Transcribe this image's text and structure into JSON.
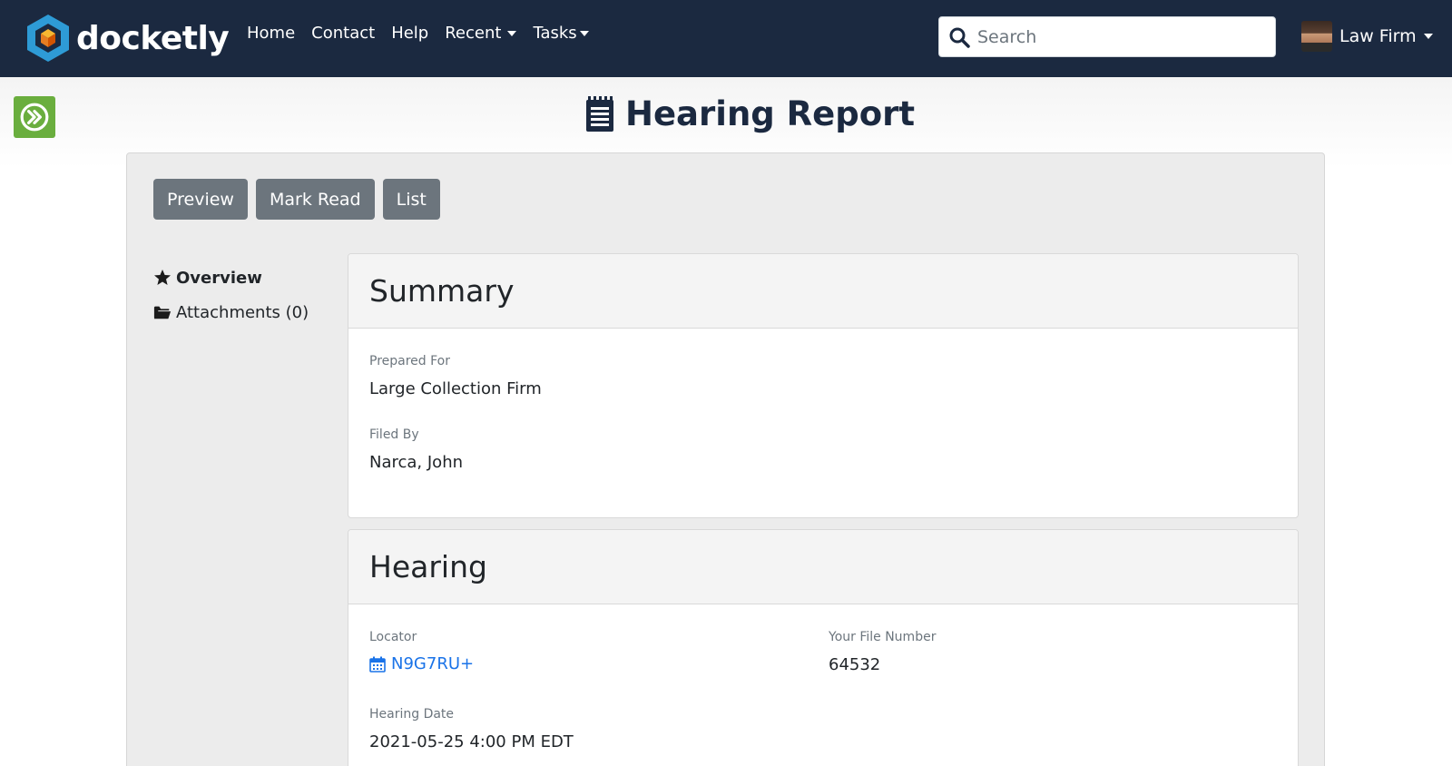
{
  "brand": {
    "name": "docketly",
    "colors": {
      "hex_blue": "#2e9bd6",
      "hex_orange": "#f39c12"
    }
  },
  "nav": {
    "links": [
      "Home",
      "Contact",
      "Help",
      "Recent",
      "Tasks"
    ],
    "search_placeholder": "Search",
    "user_name": "Law Firm"
  },
  "page": {
    "title": "Hearing Report",
    "title_icon": "notepad-icon"
  },
  "actions": {
    "preview": "Preview",
    "mark_read": "Mark Read",
    "list": "List"
  },
  "side_nav": {
    "overview": "Overview",
    "attachments": "Attachments (0)"
  },
  "summary": {
    "title": "Summary",
    "prepared_for_label": "Prepared For",
    "prepared_for": "Large Collection Firm",
    "filed_by_label": "Filed By",
    "filed_by": "Narca, John"
  },
  "hearing": {
    "title": "Hearing",
    "locator_label": "Locator",
    "locator": "N9G7RU+",
    "file_number_label": "Your File Number",
    "file_number": "64532",
    "date_label": "Hearing Date",
    "date": "2021-05-25 4:00 PM EDT"
  },
  "colors": {
    "navbar": "#1b2940",
    "button": "#6c757d",
    "link": "#1a73e8",
    "toggle": "#6aae3e"
  }
}
